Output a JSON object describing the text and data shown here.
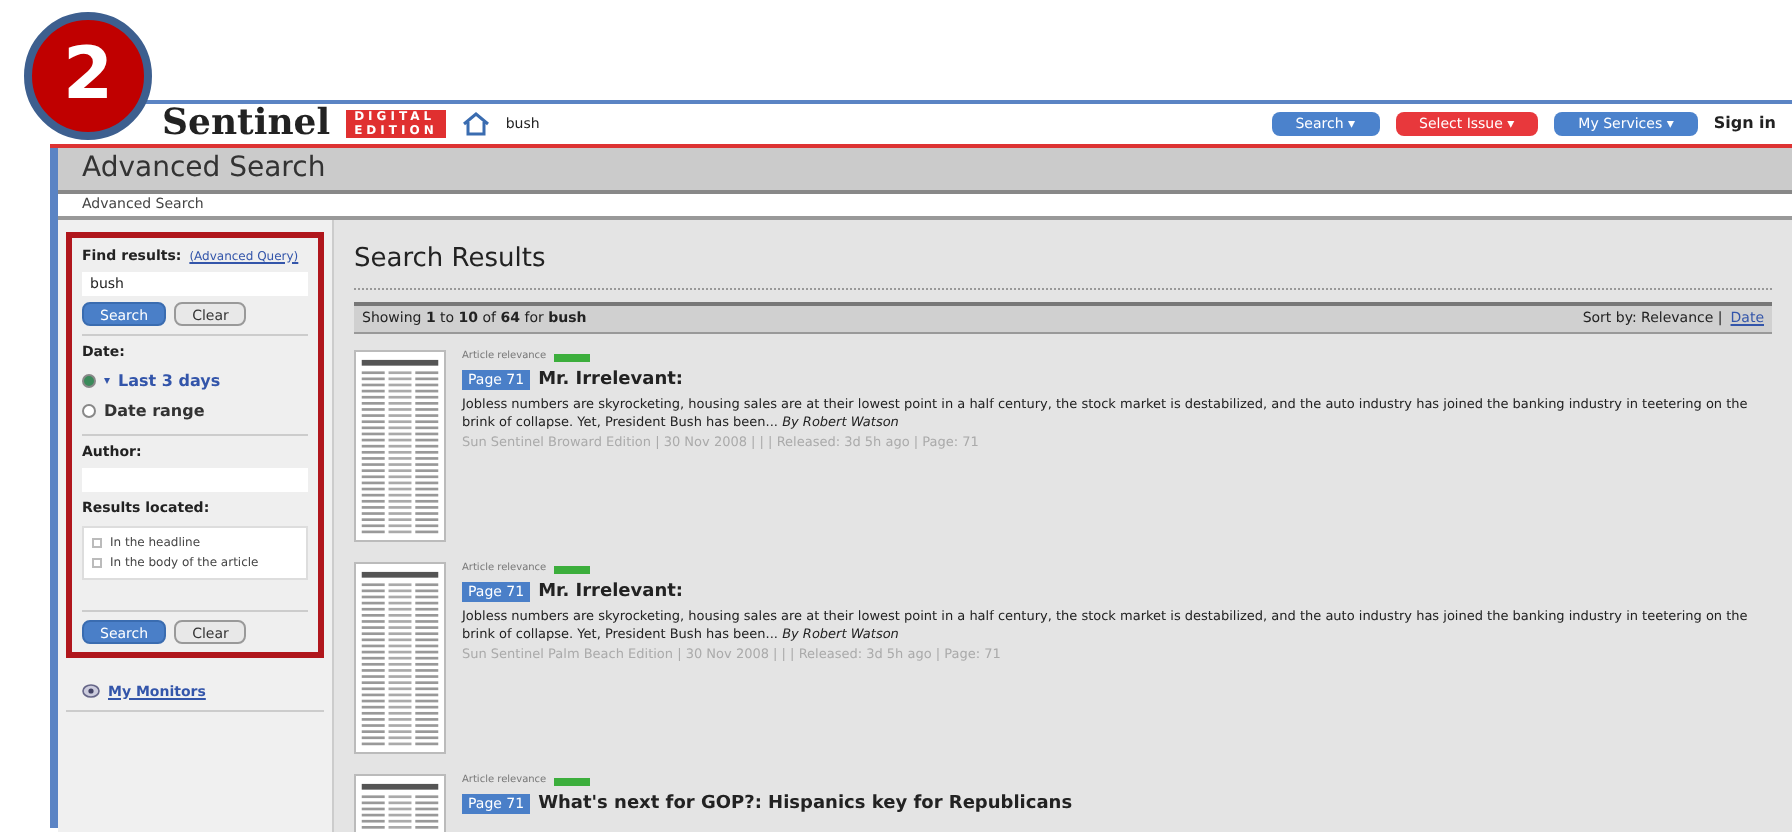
{
  "step_badge": "2",
  "header": {
    "logo": "Sentinel",
    "edition": [
      "DIGITAL",
      "EDITION"
    ],
    "search_value": "bush",
    "menus": [
      {
        "label": "Search ▾",
        "kind": "blue"
      },
      {
        "label": "Select Issue ▾",
        "kind": "red"
      },
      {
        "label": "My Services ▾",
        "kind": "blue"
      }
    ],
    "sign_in": "Sign in"
  },
  "page_title": "Advanced Search",
  "breadcrumb": "Advanced Search",
  "sidebar": {
    "find_label": "Find results:",
    "advanced_link": "(Advanced Query)",
    "query": "bush",
    "search_button": "Search",
    "clear_button": "Clear",
    "date_label": "Date:",
    "date_options": [
      {
        "label": "Last 3 days",
        "selected": true,
        "dropdown": "▾"
      },
      {
        "label": "Date range",
        "selected": false
      }
    ],
    "author_label": "Author:",
    "located_label": "Results located:",
    "located_options": [
      {
        "label": "In the headline",
        "checked": false
      },
      {
        "label": "In the body of the article",
        "checked": false
      }
    ],
    "bottom_search_button": "Search",
    "bottom_clear_button": "Clear",
    "monitors_link": "My Monitors"
  },
  "results": {
    "title": "Search Results",
    "summary": "Showing **1** to **10** of **64** for **bush**",
    "sort_label": "Sort by: Relevance |",
    "sort_link": "Date",
    "items": [
      {
        "relevance_label": "Article relevance",
        "level": 1,
        "page": "Page 71",
        "headline": "Mr. Irrelevant:",
        "snippet": "Jobless numbers are skyrocketing, housing sales are at their lowest point in a half century, the stock market is destabilized, and the auto industry has joined the banking industry in teetering on the brink of collapse. Yet, President Bush has been... *By Robert Watson*",
        "meta": "Sun Sentinel Broward Edition | 30 Nov 2008 | | | Released: 3d 5h ago | Page: 71"
      },
      {
        "relevance_label": "Article relevance",
        "level": 1,
        "page": "Page 71",
        "headline": "Mr. Irrelevant:",
        "snippet": "Jobless numbers are skyrocketing, housing sales are at their lowest point in a half century, the stock market is destabilized, and the auto industry has joined the banking industry in teetering on the brink of collapse. Yet, President Bush has been... *By Robert Watson*",
        "meta": "Sun Sentinel Palm Beach Edition | 30 Nov 2008 | | | Released: 3d 5h ago | Page: 71"
      },
      {
        "relevance_label": "Article relevance",
        "level": 1,
        "page": "Page 71",
        "headline": "What's next for GOP?: Hispanics key for Republicans"
      }
    ]
  }
}
